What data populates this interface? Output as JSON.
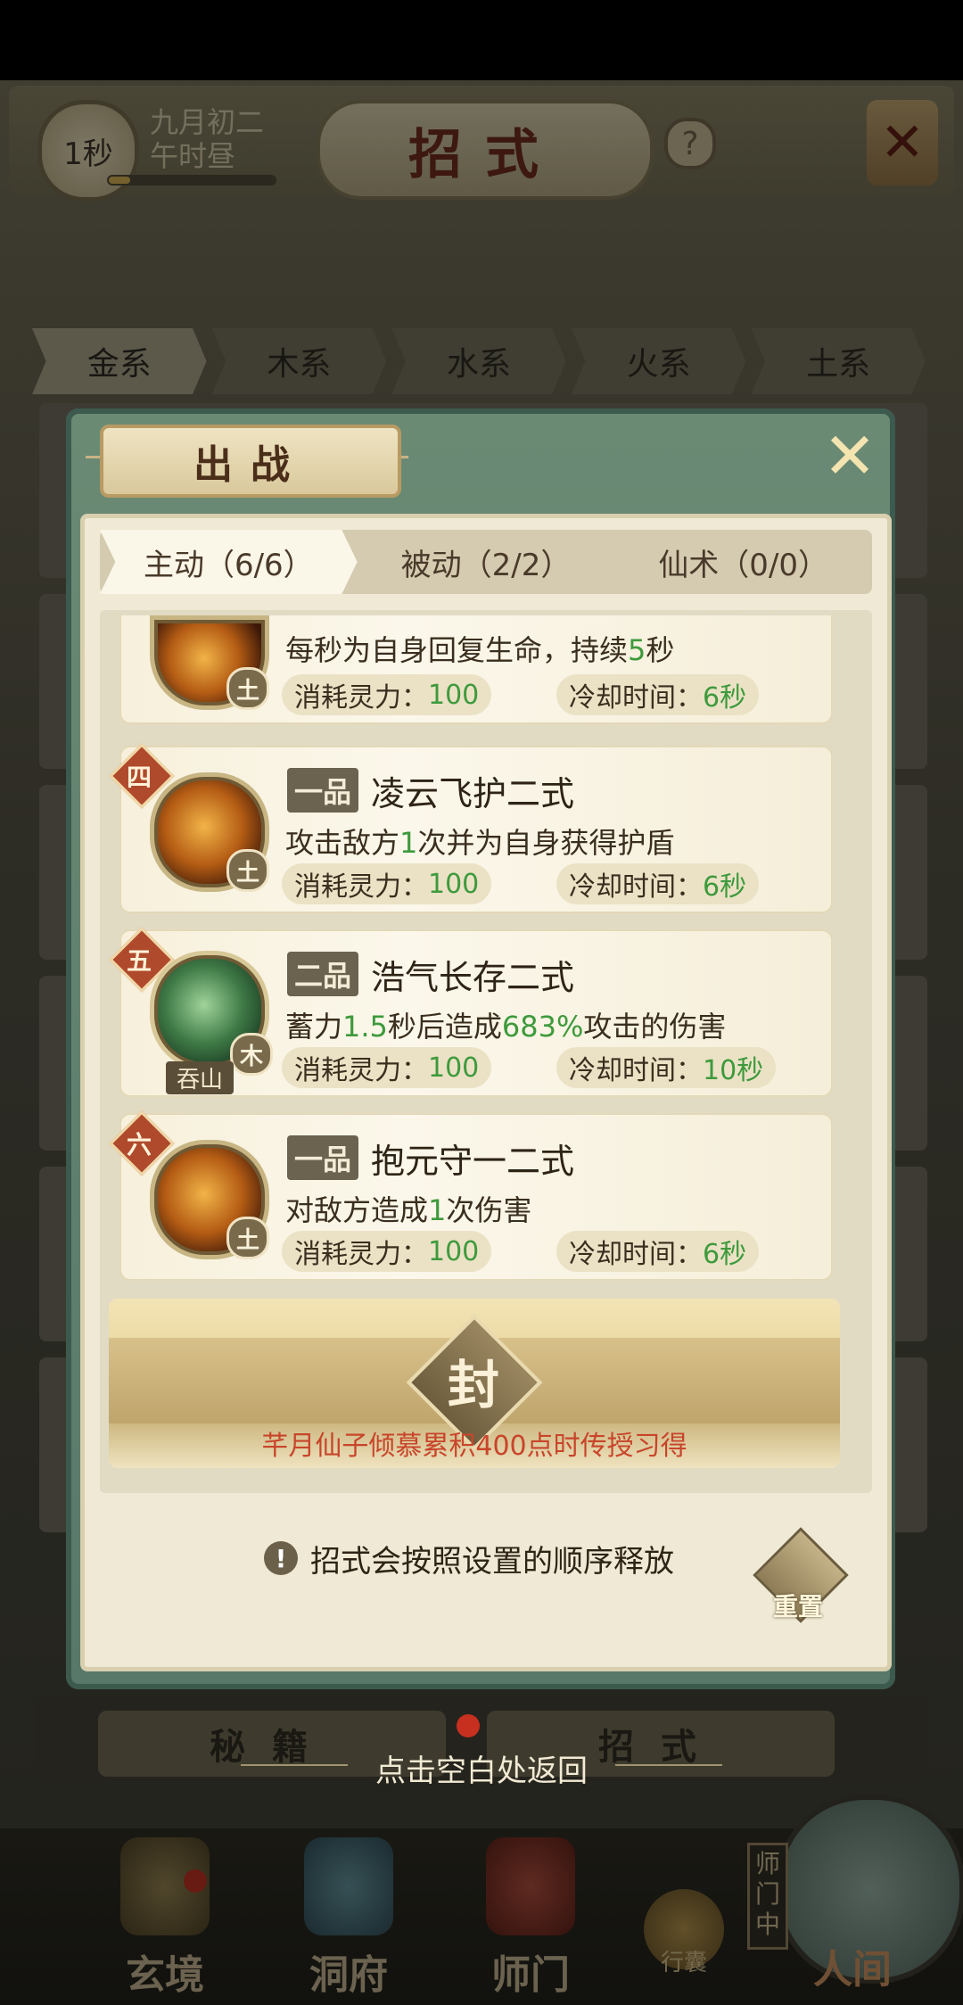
{
  "top_bar": {
    "timer": "1秒",
    "date_line1": "九月初二",
    "date_line2": "午时昼",
    "title": "招式",
    "help": "?",
    "close": "✕"
  },
  "element_tabs": [
    "金系",
    "木系",
    "水系",
    "火系",
    "土系"
  ],
  "modal": {
    "title": "出战",
    "close": "✕",
    "sub_tabs": [
      "主动（6/6）",
      "被动（2/2）",
      "仙术（0/0）"
    ],
    "skills": [
      {
        "desc_parts": [
          "每秒为自身回复生命，持续",
          "5",
          "秒"
        ],
        "cost_label": "消耗灵力：",
        "cost": "100",
        "cd_label": "冷却时间：",
        "cd": "6秒",
        "element": "土"
      },
      {
        "num": "四",
        "grade": "一品",
        "name": "凌云飞护二式",
        "desc_parts": [
          "攻击敌方",
          "1",
          "次并为自身获得护盾"
        ],
        "cost_label": "消耗灵力：",
        "cost": "100",
        "cd_label": "冷却时间：",
        "cd": "6秒",
        "element": "土"
      },
      {
        "num": "五",
        "grade": "二品",
        "name": "浩气长存二式",
        "desc_parts": [
          "蓄力",
          "1.5",
          "秒后造成",
          "683%",
          "攻击的伤害"
        ],
        "cost_label": "消耗灵力：",
        "cost": "100",
        "cd_label": "冷却时间：",
        "cd": "10秒",
        "element": "木",
        "char": "吞山"
      },
      {
        "num": "六",
        "grade": "一品",
        "name": "抱元守一二式",
        "desc_parts": [
          "对敌方造成",
          "1",
          "次伤害"
        ],
        "cost_label": "消耗灵力：",
        "cost": "100",
        "cd_label": "冷却时间：",
        "cd": "6秒",
        "element": "土"
      }
    ],
    "seal": {
      "char": "封",
      "text": "芊月仙子倾慕累积400点时传授习得"
    },
    "hint_icon": "!",
    "hint": "招式会按照设置的顺序释放",
    "reset": "重置"
  },
  "bottom_tabs": [
    "秘籍",
    "招式"
  ],
  "return_hint": "点击空白处返回",
  "nav": {
    "items": [
      "玄境",
      "洞府",
      "师门"
    ],
    "bag": "行囊",
    "shimen_tag": "师门中",
    "world": "人间"
  }
}
